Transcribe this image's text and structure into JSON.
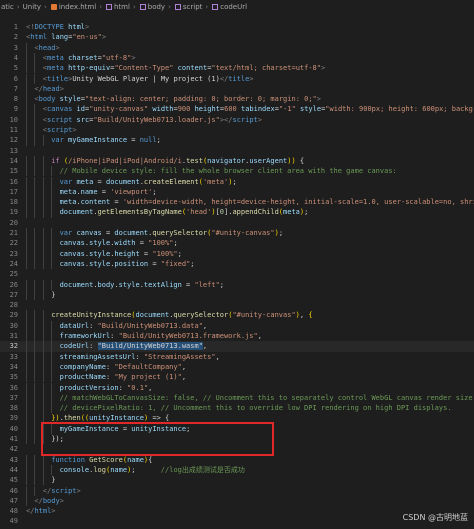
{
  "breadcrumb": [
    {
      "label": "atic",
      "icon": ""
    },
    {
      "label": "Unity",
      "icon": ""
    },
    {
      "label": "index.html",
      "icon": "html-file-icon"
    },
    {
      "label": "html",
      "icon": "html-tag-icon"
    },
    {
      "label": "body",
      "icon": "html-tag-icon"
    },
    {
      "label": "script",
      "icon": "html-tag-icon"
    },
    {
      "label": "codeUrl",
      "icon": "property-icon"
    }
  ],
  "breadcrumb_separator": "›",
  "active_line": 32,
  "watermark": "CSDN @古明地蓝",
  "colors": {
    "background": "#1e1e1e",
    "highlight_box": "#e02828",
    "keyword": "#569cd6",
    "string": "#ce9178",
    "comment": "#6a9955",
    "function": "#dcdcaa",
    "variable": "#9cdcfe"
  },
  "code_lines": [
    {
      "n": "1",
      "indent": 0,
      "tokens": [
        [
          "t-pun",
          "<!"
        ],
        [
          "t-tag",
          "DOCTYPE"
        ],
        [
          "t-attr",
          " html"
        ],
        [
          "t-pun",
          ">"
        ]
      ]
    },
    {
      "n": "2",
      "indent": 0,
      "tokens": [
        [
          "t-pun",
          "<"
        ],
        [
          "t-tag",
          "html"
        ],
        [
          "t-attr",
          " lang"
        ],
        [
          "t-txt",
          "="
        ],
        [
          "t-str",
          "\"en-us\""
        ],
        [
          "t-pun",
          ">"
        ]
      ]
    },
    {
      "n": "3",
      "indent": 1,
      "tokens": [
        [
          "t-pun",
          "<"
        ],
        [
          "t-tag",
          "head"
        ],
        [
          "t-pun",
          ">"
        ]
      ]
    },
    {
      "n": "4",
      "indent": 2,
      "tokens": [
        [
          "t-pun",
          "<"
        ],
        [
          "t-tag",
          "meta"
        ],
        [
          "t-attr",
          " charset"
        ],
        [
          "t-txt",
          "="
        ],
        [
          "t-str",
          "\"utf-8\""
        ],
        [
          "t-pun",
          ">"
        ]
      ]
    },
    {
      "n": "5",
      "indent": 2,
      "tokens": [
        [
          "t-pun",
          "<"
        ],
        [
          "t-tag",
          "meta"
        ],
        [
          "t-attr",
          " http-equiv"
        ],
        [
          "t-txt",
          "="
        ],
        [
          "t-str",
          "\"Content-Type\""
        ],
        [
          "t-attr",
          " content"
        ],
        [
          "t-txt",
          "="
        ],
        [
          "t-str",
          "\"text/html; charset=utf-8\""
        ],
        [
          "t-pun",
          ">"
        ]
      ]
    },
    {
      "n": "6",
      "indent": 2,
      "tokens": [
        [
          "t-pun",
          "<"
        ],
        [
          "t-tag",
          "title"
        ],
        [
          "t-pun",
          ">"
        ],
        [
          "t-txt",
          "Unity WebGL Player | My project (1)"
        ],
        [
          "t-pun",
          "</"
        ],
        [
          "t-tag",
          "title"
        ],
        [
          "t-pun",
          ">"
        ]
      ]
    },
    {
      "n": "7",
      "indent": 1,
      "tokens": [
        [
          "t-pun",
          "</"
        ],
        [
          "t-tag",
          "head"
        ],
        [
          "t-pun",
          ">"
        ]
      ]
    },
    {
      "n": "8",
      "indent": 1,
      "tokens": [
        [
          "t-pun",
          "<"
        ],
        [
          "t-tag",
          "body"
        ],
        [
          "t-attr",
          " style"
        ],
        [
          "t-txt",
          "="
        ],
        [
          "t-str",
          "\"text-align: center; padding: 0; border: 0; margin: 0;\""
        ],
        [
          "t-pun",
          ">"
        ]
      ]
    },
    {
      "n": "9",
      "indent": 2,
      "tokens": [
        [
          "t-pun",
          "<"
        ],
        [
          "t-tag",
          "canvas"
        ],
        [
          "t-attr",
          " id"
        ],
        [
          "t-txt",
          "="
        ],
        [
          "t-str",
          "\"unity-canvas\""
        ],
        [
          "t-attr",
          " width"
        ],
        [
          "t-txt",
          "="
        ],
        [
          "t-str",
          "900"
        ],
        [
          "t-attr",
          " height"
        ],
        [
          "t-txt",
          "="
        ],
        [
          "t-str",
          "600"
        ],
        [
          "t-attr",
          " tabindex"
        ],
        [
          "t-txt",
          "="
        ],
        [
          "t-str",
          "\"-1\""
        ],
        [
          "t-attr",
          " style"
        ],
        [
          "t-txt",
          "="
        ],
        [
          "t-str",
          "\"width: 900px; height: 600px; background:"
        ]
      ]
    },
    {
      "n": "10",
      "indent": 2,
      "tokens": [
        [
          "t-pun",
          "<"
        ],
        [
          "t-tag",
          "script"
        ],
        [
          "t-attr",
          " src"
        ],
        [
          "t-txt",
          "="
        ],
        [
          "t-str",
          "\"Build/UnityWeb0713.loader.js\""
        ],
        [
          "t-pun",
          "></"
        ],
        [
          "t-tag",
          "script"
        ],
        [
          "t-pun",
          ">"
        ]
      ]
    },
    {
      "n": "11",
      "indent": 2,
      "tokens": [
        [
          "t-pun",
          "<"
        ],
        [
          "t-tag",
          "script"
        ],
        [
          "t-pun",
          ">"
        ]
      ]
    },
    {
      "n": "12",
      "indent": 3,
      "tokens": [
        [
          "t-kw",
          "var"
        ],
        [
          "t-var",
          " myGameInstance"
        ],
        [
          "t-txt",
          " = "
        ],
        [
          "t-kw",
          "null"
        ],
        [
          "t-txt",
          ";"
        ]
      ]
    },
    {
      "n": "13",
      "indent": 0,
      "tokens": []
    },
    {
      "n": "14",
      "indent": 3,
      "tokens": [
        [
          "t-ctl",
          "if"
        ],
        [
          "t-txt",
          " "
        ],
        [
          "t-brk",
          "("
        ],
        [
          "t-str",
          "/iPhone|iPad|iPod|Android/i"
        ],
        [
          "t-txt",
          "."
        ],
        [
          "t-fn",
          "test"
        ],
        [
          "t-brk",
          "("
        ],
        [
          "t-var",
          "navigator"
        ],
        [
          "t-txt",
          "."
        ],
        [
          "t-var",
          "userAgent"
        ],
        [
          "t-brk",
          "))"
        ],
        [
          "t-txt",
          " {"
        ]
      ]
    },
    {
      "n": "15",
      "indent": 4,
      "tokens": [
        [
          "t-com",
          "// Mobile device style: fill the whole browser client area with the game canvas:"
        ]
      ]
    },
    {
      "n": "16",
      "indent": 4,
      "tokens": [
        [
          "t-kw",
          "var"
        ],
        [
          "t-var",
          " meta"
        ],
        [
          "t-txt",
          " = "
        ],
        [
          "t-var",
          "document"
        ],
        [
          "t-txt",
          "."
        ],
        [
          "t-fn",
          "createElement"
        ],
        [
          "t-brk",
          "("
        ],
        [
          "t-str",
          "'meta'"
        ],
        [
          "t-brk",
          ")"
        ],
        [
          "t-txt",
          ";"
        ]
      ]
    },
    {
      "n": "17",
      "indent": 4,
      "tokens": [
        [
          "t-var",
          "meta"
        ],
        [
          "t-txt",
          "."
        ],
        [
          "t-var",
          "name"
        ],
        [
          "t-txt",
          " = "
        ],
        [
          "t-str",
          "'viewport'"
        ],
        [
          "t-txt",
          ";"
        ]
      ]
    },
    {
      "n": "18",
      "indent": 4,
      "tokens": [
        [
          "t-var",
          "meta"
        ],
        [
          "t-txt",
          "."
        ],
        [
          "t-var",
          "content"
        ],
        [
          "t-txt",
          " = "
        ],
        [
          "t-str",
          "'width=device-width, height=device-height, initial-scale=1.0, user-scalable=no, shrink-to-"
        ]
      ]
    },
    {
      "n": "19",
      "indent": 4,
      "tokens": [
        [
          "t-var",
          "document"
        ],
        [
          "t-txt",
          "."
        ],
        [
          "t-fn",
          "getElementsByTagName"
        ],
        [
          "t-brk",
          "("
        ],
        [
          "t-str",
          "'head'"
        ],
        [
          "t-brk",
          ")"
        ],
        [
          "t-txt",
          "["
        ],
        [
          "t-num",
          "0"
        ],
        [
          "t-txt",
          "]."
        ],
        [
          "t-fn",
          "appendChild"
        ],
        [
          "t-brk",
          "("
        ],
        [
          "t-var",
          "meta"
        ],
        [
          "t-brk",
          ")"
        ],
        [
          "t-txt",
          ";"
        ]
      ]
    },
    {
      "n": "20",
      "indent": 0,
      "tokens": []
    },
    {
      "n": "21",
      "indent": 4,
      "tokens": [
        [
          "t-kw",
          "var"
        ],
        [
          "t-var",
          " canvas"
        ],
        [
          "t-txt",
          " = "
        ],
        [
          "t-var",
          "document"
        ],
        [
          "t-txt",
          "."
        ],
        [
          "t-fn",
          "querySelector"
        ],
        [
          "t-brk",
          "("
        ],
        [
          "t-str",
          "\"#unity-canvas\""
        ],
        [
          "t-brk",
          ")"
        ],
        [
          "t-txt",
          ";"
        ]
      ]
    },
    {
      "n": "22",
      "indent": 4,
      "tokens": [
        [
          "t-var",
          "canvas"
        ],
        [
          "t-txt",
          "."
        ],
        [
          "t-var",
          "style"
        ],
        [
          "t-txt",
          "."
        ],
        [
          "t-var",
          "width"
        ],
        [
          "t-txt",
          " = "
        ],
        [
          "t-str",
          "\"100%\""
        ],
        [
          "t-txt",
          ";"
        ]
      ]
    },
    {
      "n": "23",
      "indent": 4,
      "tokens": [
        [
          "t-var",
          "canvas"
        ],
        [
          "t-txt",
          "."
        ],
        [
          "t-var",
          "style"
        ],
        [
          "t-txt",
          "."
        ],
        [
          "t-var",
          "height"
        ],
        [
          "t-txt",
          " = "
        ],
        [
          "t-str",
          "\"100%\""
        ],
        [
          "t-txt",
          ";"
        ]
      ]
    },
    {
      "n": "24",
      "indent": 4,
      "tokens": [
        [
          "t-var",
          "canvas"
        ],
        [
          "t-txt",
          "."
        ],
        [
          "t-var",
          "style"
        ],
        [
          "t-txt",
          "."
        ],
        [
          "t-var",
          "position"
        ],
        [
          "t-txt",
          " = "
        ],
        [
          "t-str",
          "\"fixed\""
        ],
        [
          "t-txt",
          ";"
        ]
      ]
    },
    {
      "n": "25",
      "indent": 0,
      "tokens": []
    },
    {
      "n": "26",
      "indent": 4,
      "tokens": [
        [
          "t-var",
          "document"
        ],
        [
          "t-txt",
          "."
        ],
        [
          "t-var",
          "body"
        ],
        [
          "t-txt",
          "."
        ],
        [
          "t-var",
          "style"
        ],
        [
          "t-txt",
          "."
        ],
        [
          "t-var",
          "textAlign"
        ],
        [
          "t-txt",
          " = "
        ],
        [
          "t-str",
          "\"left\""
        ],
        [
          "t-txt",
          ";"
        ]
      ]
    },
    {
      "n": "27",
      "indent": 3,
      "tokens": [
        [
          "t-txt",
          "}"
        ]
      ]
    },
    {
      "n": "28",
      "indent": 0,
      "tokens": []
    },
    {
      "n": "29",
      "indent": 3,
      "tokens": [
        [
          "t-fn",
          "createUnityInstance"
        ],
        [
          "t-brk",
          "("
        ],
        [
          "t-var",
          "document"
        ],
        [
          "t-txt",
          "."
        ],
        [
          "t-fn",
          "querySelector"
        ],
        [
          "t-brk",
          "("
        ],
        [
          "t-str",
          "\"#unity-canvas\""
        ],
        [
          "t-brk",
          ")"
        ],
        [
          "t-txt",
          ", "
        ],
        [
          "t-brk",
          "{"
        ]
      ]
    },
    {
      "n": "30",
      "indent": 4,
      "tokens": [
        [
          "t-var",
          "dataUrl"
        ],
        [
          "t-txt",
          ": "
        ],
        [
          "t-str",
          "\"Build/UnityWeb0713.data\""
        ],
        [
          "t-txt",
          ","
        ]
      ]
    },
    {
      "n": "31",
      "indent": 4,
      "tokens": [
        [
          "t-var",
          "frameworkUrl"
        ],
        [
          "t-txt",
          ": "
        ],
        [
          "t-str",
          "\"Build/UnityWeb0713.framework.js\""
        ],
        [
          "t-txt",
          ","
        ]
      ]
    },
    {
      "n": "32",
      "indent": 4,
      "tokens": [
        [
          "t-var",
          "codeUrl"
        ],
        [
          "t-txt",
          ": "
        ],
        [
          "t-sel",
          "\"Build/UnityWeb0713.wasm\""
        ],
        [
          "t-txt",
          ","
        ]
      ]
    },
    {
      "n": "33",
      "indent": 4,
      "tokens": [
        [
          "t-var",
          "streamingAssetsUrl"
        ],
        [
          "t-txt",
          ": "
        ],
        [
          "t-str",
          "\"StreamingAssets\""
        ],
        [
          "t-txt",
          ","
        ]
      ]
    },
    {
      "n": "34",
      "indent": 4,
      "tokens": [
        [
          "t-var",
          "companyName"
        ],
        [
          "t-txt",
          ": "
        ],
        [
          "t-str",
          "\"DefaultCompany\""
        ],
        [
          "t-txt",
          ","
        ]
      ]
    },
    {
      "n": "35",
      "indent": 4,
      "tokens": [
        [
          "t-var",
          "productName"
        ],
        [
          "t-txt",
          ": "
        ],
        [
          "t-str",
          "\"My project (1)\""
        ],
        [
          "t-txt",
          ","
        ]
      ]
    },
    {
      "n": "36",
      "indent": 4,
      "tokens": [
        [
          "t-var",
          "productVersion"
        ],
        [
          "t-txt",
          ": "
        ],
        [
          "t-str",
          "\"0.1\""
        ],
        [
          "t-txt",
          ","
        ]
      ]
    },
    {
      "n": "37",
      "indent": 4,
      "tokens": [
        [
          "t-com",
          "// matchWebGLToCanvasSize: false, // Uncomment this to separately control WebGL canvas render size and DOM"
        ]
      ]
    },
    {
      "n": "38",
      "indent": 4,
      "tokens": [
        [
          "t-com",
          "// devicePixelRatio: 1, // Uncomment this to override low DPI rendering on high DPI displays."
        ]
      ]
    },
    {
      "n": "39",
      "indent": 3,
      "tokens": [
        [
          "t-brk",
          "})"
        ],
        [
          "t-txt",
          "."
        ],
        [
          "t-fn",
          "then"
        ],
        [
          "t-brk",
          "("
        ],
        [
          "t-brk",
          "("
        ],
        [
          "t-var",
          "unityInstance"
        ],
        [
          "t-brk",
          ")"
        ],
        [
          "t-txt",
          " => {"
        ]
      ]
    },
    {
      "n": "40",
      "indent": 4,
      "tokens": [
        [
          "t-var",
          "myGameInstance"
        ],
        [
          "t-txt",
          " = "
        ],
        [
          "t-var",
          "unityInstance"
        ],
        [
          "t-txt",
          ";"
        ]
      ]
    },
    {
      "n": "41",
      "indent": 3,
      "tokens": [
        [
          "t-txt",
          "});"
        ]
      ]
    },
    {
      "n": "42",
      "indent": 0,
      "tokens": []
    },
    {
      "n": "43",
      "indent": 3,
      "tokens": [
        [
          "t-kw",
          "function"
        ],
        [
          "t-txt",
          " "
        ],
        [
          "t-fn",
          "GetScore"
        ],
        [
          "t-brk",
          "("
        ],
        [
          "t-var",
          "name"
        ],
        [
          "t-brk",
          ")"
        ],
        [
          "t-txt",
          "{"
        ]
      ]
    },
    {
      "n": "44",
      "indent": 4,
      "tokens": [
        [
          "t-var",
          "console"
        ],
        [
          "t-txt",
          "."
        ],
        [
          "t-fn",
          "log"
        ],
        [
          "t-brk",
          "("
        ],
        [
          "t-var",
          "name"
        ],
        [
          "t-brk",
          ")"
        ],
        [
          "t-txt",
          ";      "
        ],
        [
          "t-com",
          "//log出成绩测试是否成功"
        ]
      ]
    },
    {
      "n": "45",
      "indent": 3,
      "tokens": [
        [
          "t-txt",
          "}"
        ]
      ]
    },
    {
      "n": "46",
      "indent": 2,
      "tokens": [
        [
          "t-pun",
          "</"
        ],
        [
          "t-tag",
          "script"
        ],
        [
          "t-pun",
          ">"
        ]
      ]
    },
    {
      "n": "47",
      "indent": 1,
      "tokens": [
        [
          "t-pun",
          "</"
        ],
        [
          "t-tag",
          "body"
        ],
        [
          "t-pun",
          ">"
        ]
      ]
    },
    {
      "n": "48",
      "indent": 0,
      "tokens": [
        [
          "t-pun",
          "</"
        ],
        [
          "t-tag",
          "html"
        ],
        [
          "t-pun",
          ">"
        ]
      ]
    },
    {
      "n": "49",
      "indent": 0,
      "tokens": []
    }
  ]
}
